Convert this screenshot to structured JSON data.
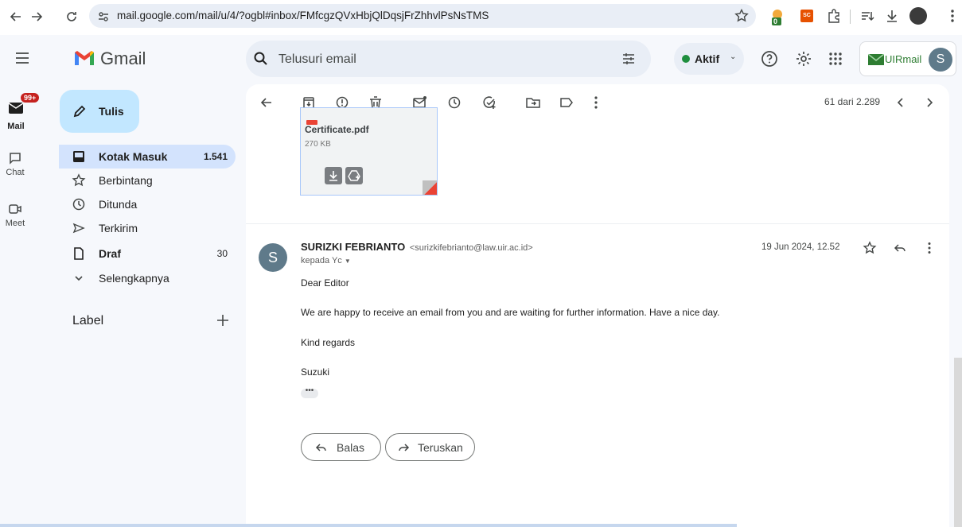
{
  "browser": {
    "url": "mail.google.com/mail/u/4/?ogbl#inbox/FMfcgzQVxHbjQlDqsjFrZhhvlPsNsTMS",
    "extension_badge": "0",
    "extension_label": "SC"
  },
  "app": {
    "title": "Gmail"
  },
  "search": {
    "placeholder": "Telusuri email"
  },
  "header": {
    "status_label": "Aktif",
    "account_brand": "UIRmail",
    "account_initial": "S"
  },
  "rail": {
    "mail_badge": "99+",
    "mail_label": "Mail",
    "chat_label": "Chat",
    "meet_label": "Meet"
  },
  "sidebar": {
    "compose_label": "Tulis",
    "items": [
      {
        "label": "Kotak Masuk",
        "count": "1.541",
        "icon": "inbox-icon"
      },
      {
        "label": "Berbintang",
        "count": "",
        "icon": "star-icon"
      },
      {
        "label": "Ditunda",
        "count": "",
        "icon": "clock-icon"
      },
      {
        "label": "Terkirim",
        "count": "",
        "icon": "send-icon"
      },
      {
        "label": "Draf",
        "count": "30",
        "icon": "draft-icon"
      },
      {
        "label": "Selengkapnya",
        "count": "",
        "icon": "chevron-down-icon"
      }
    ],
    "labels_heading": "Label"
  },
  "toolbar": {
    "pager_text": "61 dari 2.289"
  },
  "attachment": {
    "filename": "Certificate.pdf",
    "size": "270 KB"
  },
  "message": {
    "sender_name": "SURIZKI FEBRIANTO",
    "sender_email": "<surizkifebrianto@law.uir.ac.id>",
    "recipient": "kepada Yc",
    "date": "19 Jun 2024, 12.52",
    "avatar_initial": "S",
    "body": [
      "Dear Editor",
      "We are happy to receive an email from you and are waiting for further information. Have a nice day.",
      "Kind regards",
      "Suzuki"
    ],
    "ellipsis": "•••"
  },
  "actions": {
    "reply_label": "Balas",
    "forward_label": "Teruskan"
  },
  "colors": {
    "accent": "#0b57d0",
    "compose": "#c2e7ff",
    "active_nav": "#d3e3fd",
    "status_green": "#1e8e3e",
    "gmail_red": "#ea4335"
  }
}
